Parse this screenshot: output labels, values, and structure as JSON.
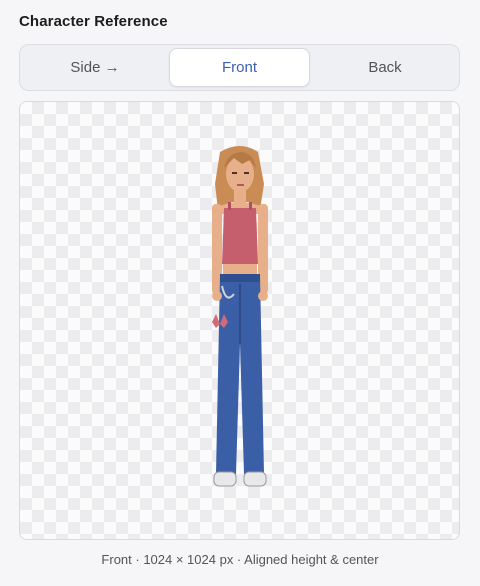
{
  "panel": {
    "title": "Character Reference"
  },
  "tabs": [
    {
      "label": "Side →",
      "active": false
    },
    {
      "label": "Front",
      "active": true
    },
    {
      "label": "Back",
      "active": false
    }
  ],
  "caption": "Front · 1024 × 1024 px · Aligned height & center",
  "colors": {
    "accent": "#3f5fb0",
    "jeans": "#3b5fa6",
    "top": "#c55f6e",
    "hair": "#c98c55",
    "skin": "#e7b08a"
  }
}
